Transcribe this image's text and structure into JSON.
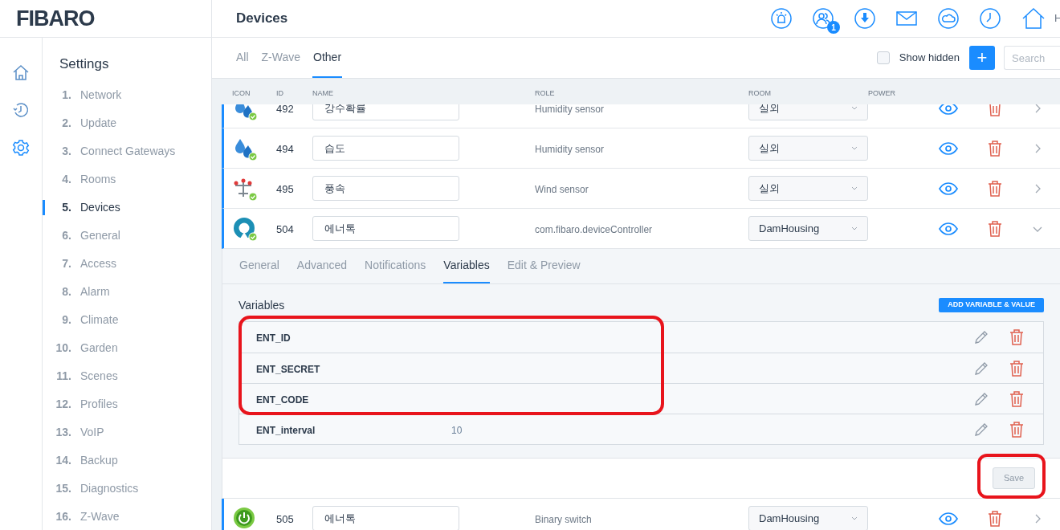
{
  "header": {
    "logo": "FIBARO",
    "title": "Devices",
    "badge": "1",
    "user_initial": "H"
  },
  "rail": [
    {
      "selected": false
    },
    {
      "selected": false
    },
    {
      "selected": true
    }
  ],
  "sidebar": {
    "title": "Settings",
    "items": [
      {
        "number": "1.",
        "label": "Network",
        "selected": false
      },
      {
        "number": "2.",
        "label": "Update",
        "selected": false
      },
      {
        "number": "3.",
        "label": "Connect Gateways",
        "selected": false
      },
      {
        "number": "4.",
        "label": "Rooms",
        "selected": false
      },
      {
        "number": "5.",
        "label": "Devices",
        "selected": true
      },
      {
        "number": "6.",
        "label": "General",
        "selected": false
      },
      {
        "number": "7.",
        "label": "Access",
        "selected": false
      },
      {
        "number": "8.",
        "label": "Alarm",
        "selected": false
      },
      {
        "number": "9.",
        "label": "Climate",
        "selected": false
      },
      {
        "number": "10.",
        "label": "Garden",
        "selected": false
      },
      {
        "number": "11.",
        "label": "Scenes",
        "selected": false
      },
      {
        "number": "12.",
        "label": "Profiles",
        "selected": false
      },
      {
        "number": "13.",
        "label": "VoIP",
        "selected": false
      },
      {
        "number": "14.",
        "label": "Backup",
        "selected": false
      },
      {
        "number": "15.",
        "label": "Diagnostics",
        "selected": false
      },
      {
        "number": "16.",
        "label": "Z-Wave",
        "selected": false
      }
    ]
  },
  "tabs": [
    {
      "label": "All",
      "selected": false
    },
    {
      "label": "Z-Wave",
      "selected": false
    },
    {
      "label": "Other",
      "selected": true
    }
  ],
  "toolbar": {
    "show_hidden": {
      "label": "Show hidden",
      "checked": false
    },
    "add_button": "+",
    "search": {
      "placeholder": "Search"
    }
  },
  "table": {
    "columns": [
      "ICON",
      "ID",
      "NAME",
      "ROLE",
      "ROOM",
      "POWER"
    ],
    "rows": [
      {
        "kind": "drops",
        "id": "492",
        "name": "강수확률",
        "role": "Humidity sensor",
        "room": "실외",
        "expanded": false
      },
      {
        "kind": "drops",
        "id": "494",
        "name": "습도",
        "role": "Humidity sensor",
        "room": "실외",
        "expanded": false
      },
      {
        "kind": "wind",
        "id": "495",
        "name": "풍속",
        "role": "Wind sensor",
        "room": "실외",
        "expanded": false
      },
      {
        "kind": "ring",
        "id": "504",
        "name": "에너톡",
        "role": "com.fibaro.deviceController",
        "room": "DamHousing",
        "expanded": true
      },
      {
        "kind": "power",
        "id": "505",
        "name": "에너톡",
        "role": "Binary switch",
        "room": "DamHousing",
        "expanded": false
      }
    ]
  },
  "detail": {
    "tabs": [
      {
        "label": "General",
        "selected": false
      },
      {
        "label": "Advanced",
        "selected": false
      },
      {
        "label": "Notifications",
        "selected": false
      },
      {
        "label": "Variables",
        "selected": true
      },
      {
        "label": "Edit & Preview",
        "selected": false
      }
    ],
    "title": "Variables",
    "add_button": "ADD VARIABLE & VALUE",
    "variables": [
      {
        "name": "ENT_ID"
      },
      {
        "name": "ENT_SECRET"
      },
      {
        "name": "ENT_CODE"
      },
      {
        "name": "ENT_interval",
        "value": "10"
      }
    ],
    "save_button": "Save"
  }
}
